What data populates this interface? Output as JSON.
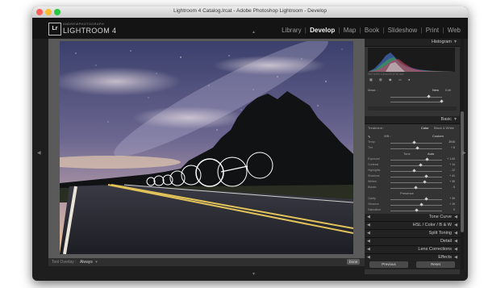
{
  "window": {
    "title": "Lightroom 4 Catalog.lrcat - Adobe Photoshop Lightroom - Develop"
  },
  "header": {
    "logo_text": "Lr",
    "owner_text": "ANDREWPHOTOGRAPH",
    "app_name": "LIGHTROOM 4",
    "modules": [
      {
        "label": "Library",
        "active": false
      },
      {
        "label": "Develop",
        "active": true
      },
      {
        "label": "Map",
        "active": false
      },
      {
        "label": "Book",
        "active": false
      },
      {
        "label": "Slideshow",
        "active": false
      },
      {
        "label": "Print",
        "active": false
      },
      {
        "label": "Web",
        "active": false
      }
    ],
    "separator": "|"
  },
  "toolbar": {
    "tool_overlay_label": "Tool Overlay :",
    "tool_overlay_value": "Always",
    "done_label": "Done"
  },
  "right_panel": {
    "histogram_title": "Histogram",
    "histogram_info": "ISO 6400  14mm  f/2.8  30 sec",
    "mask_section": {
      "label": "Mask :",
      "option_new": "New",
      "option_edit": "Edit"
    },
    "basic_title": "Basic",
    "treatment_label": "Treatment :",
    "treatment_color": "Color",
    "treatment_bw": "Black & White",
    "wb_label": "WB :",
    "wb_value": "Custom",
    "tone_label": "Tone",
    "tone_auto": "Auto",
    "presence_label": "Presence",
    "sliders_wb": [
      {
        "label": "Temp",
        "value": "3945",
        "pos": 0.45
      },
      {
        "label": "Tint",
        "value": "+ 8",
        "pos": 0.52
      }
    ],
    "sliders_tone": [
      {
        "label": "Exposure",
        "value": "+ 1.00",
        "pos": 0.7
      },
      {
        "label": "Contrast",
        "value": "+ 14",
        "pos": 0.58
      },
      {
        "label": "Highlights",
        "value": "- 12",
        "pos": 0.45
      },
      {
        "label": "Shadows",
        "value": "+ 41",
        "pos": 0.68
      },
      {
        "label": "Whites",
        "value": "+ 35",
        "pos": 0.66
      },
      {
        "label": "Blacks",
        "value": "- 5",
        "pos": 0.48
      }
    ],
    "sliders_presence": [
      {
        "label": "Clarity",
        "value": "+ 39",
        "pos": 0.68
      },
      {
        "label": "Vibrance",
        "value": "+ 19",
        "pos": 0.6
      },
      {
        "label": "Saturation",
        "value": "0",
        "pos": 0.5
      }
    ],
    "collapsed_panels": [
      "Tone Curve",
      "HSL / Color / B & W",
      "Split Toning",
      "Detail",
      "Lens Corrections",
      "Effects"
    ],
    "previous_label": "Previous",
    "reset_label": "Reset"
  },
  "colors": {
    "accent_active": "#f0f0f0",
    "panel_bg": "#333333",
    "header_bg": "#141414"
  }
}
